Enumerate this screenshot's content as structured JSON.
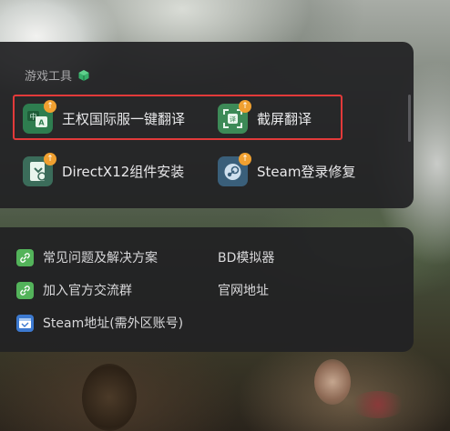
{
  "game_tools": {
    "section_title": "游戏工具",
    "tools": [
      {
        "label": "王权国际服一键翻译",
        "icon": "translate-icon"
      },
      {
        "label": "截屏翻译",
        "icon": "screenshot-translate-icon"
      },
      {
        "label": "DirectX12组件安装",
        "icon": "directx-install-icon"
      },
      {
        "label": "Steam登录修复",
        "icon": "steam-repair-icon"
      }
    ],
    "highlight_color": "#e23a3a",
    "badge_color": "#f0a030"
  },
  "links": {
    "items": [
      {
        "label": "常见问题及解决方案",
        "icon": "link-icon"
      },
      {
        "label": "加入官方交流群",
        "icon": "link-icon"
      },
      {
        "label": "Steam地址(需外区账号)",
        "icon": "steam-window-icon"
      },
      {
        "label": "BD模拟器"
      },
      {
        "label": "官网地址"
      }
    ],
    "link_icon_color": "#53b35a",
    "steam_icon_color": "#3c79d0"
  }
}
